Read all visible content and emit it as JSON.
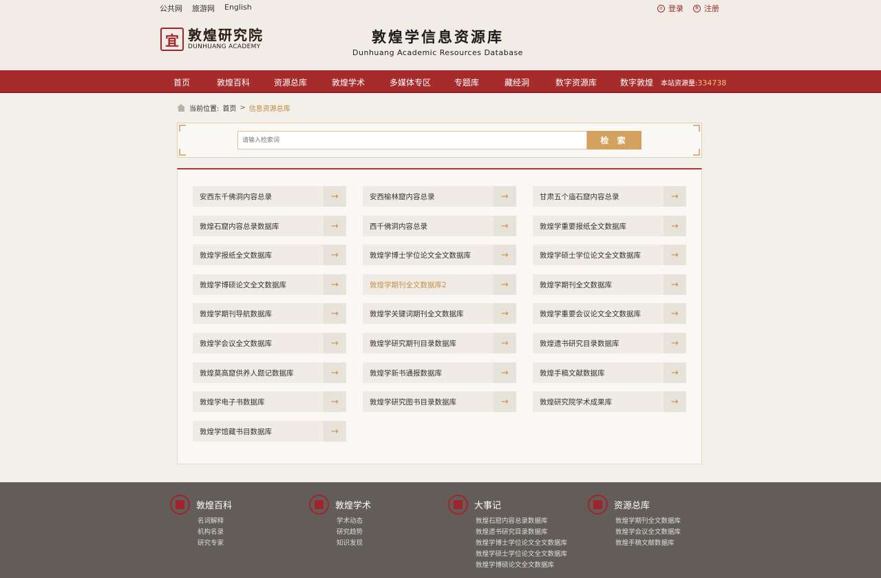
{
  "top_links": [
    "公共网",
    "旅游网",
    "English"
  ],
  "user_links": {
    "login": "登录",
    "login_icon": "⍝",
    "register": "注册",
    "register_icon": "R"
  },
  "logo": {
    "seal": "宜",
    "cn": "敦煌研究院",
    "en": "DUNHUANG ACADEMY"
  },
  "site_title": {
    "cn": "敦煌学信息资源库",
    "en": "Dunhuang Academic Resources Database"
  },
  "nav": {
    "items": [
      "首页",
      "敦煌百科",
      "资源总库",
      "敦煌学术",
      "多媒体专区",
      "专题库",
      "藏经洞",
      "数字资源库",
      "数字敦煌"
    ],
    "active_index": 2,
    "stat_label": "本站资源量:",
    "stat_value": "334738"
  },
  "breadcrumb": {
    "label": "当前位置:",
    "home": "首页",
    "sep": ">",
    "current": "信息资源总库"
  },
  "search": {
    "placeholder": "请输入检索词",
    "button": "检 索"
  },
  "databases": [
    "安西东千佛洞内容总录",
    "安西榆林窟内容总录",
    "甘肃五个庙石窟内容总录",
    "敦煌石窟内容总录数据库",
    "西千佛洞内容总录",
    "敦煌学重要报纸全文数据库",
    "敦煌学报纸全文数据库",
    "敦煌学博士学位论文全文数据库",
    "敦煌学硕士学位论文全文数据库",
    "敦煌学博硕论文全文数据库",
    "敦煌学期刊全文数据库2",
    "敦煌学期刊全文数据库",
    "敦煌学期刊导航数据库",
    "敦煌学关键词期刊全文数据库",
    "敦煌学重要会议论文全文数据库",
    "敦煌学会议全文数据库",
    "敦煌学研究期刊目录数据库",
    "敦煌遗书研究目录数据库",
    "敦煌莫高窟供养人题记数据库",
    "敦煌学新书通报数据库",
    "敦煌手稿文献数据库",
    "敦煌学电子书数据库",
    "敦煌学研究图书目录数据库",
    "敦煌研究院学术成果库",
    "敦煌学馆藏书目数据库"
  ],
  "highlight_index": 10,
  "arrow_glyph": "→",
  "accent_color": "#a72b2b",
  "footer": [
    {
      "title": "敦煌百科",
      "links": [
        "名词解释",
        "机构名录",
        "研究专家"
      ]
    },
    {
      "title": "敦煌学术",
      "links": [
        "学术动态",
        "研究趋势",
        "知识发现"
      ]
    },
    {
      "title": "大事记",
      "links": [
        "敦煌石窟内容总录数据库",
        "敦煌遗书研究目录数据库",
        "敦煌学博士学位论文全文数据库",
        "敦煌学硕士学位论文全文数据库",
        "敦煌学博硕论文全文数据库"
      ]
    },
    {
      "title": "资源总库",
      "links": [
        "敦煌学期刊全文数据库",
        "敦煌学会议全文数据库",
        "敦煌手稿文献数据库"
      ]
    }
  ]
}
